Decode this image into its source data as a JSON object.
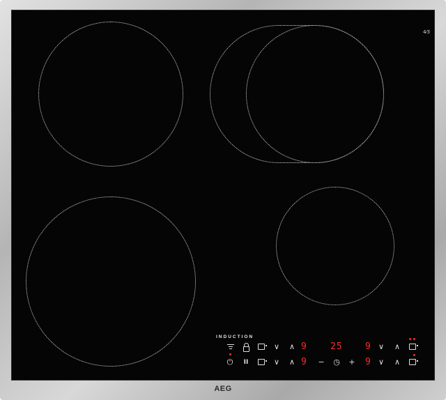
{
  "hob": {
    "brand": "AEG",
    "technology_label": "INDUCTION",
    "corner_mark": "4⁄3",
    "controls": {
      "row1": {
        "hob2hood": "⌂",
        "down": "∨",
        "up": "∧",
        "level_left": "9",
        "timer_display": "25",
        "level_right": "9",
        "down2": "∨",
        "up2": "∧"
      },
      "row2": {
        "power": "⏻",
        "pause": "II",
        "down": "∨",
        "up": "∧",
        "level_left": "9",
        "minus": "−",
        "timer": "◷",
        "plus": "+",
        "level_right": "9",
        "down2": "∨",
        "up2": "∧"
      }
    }
  }
}
